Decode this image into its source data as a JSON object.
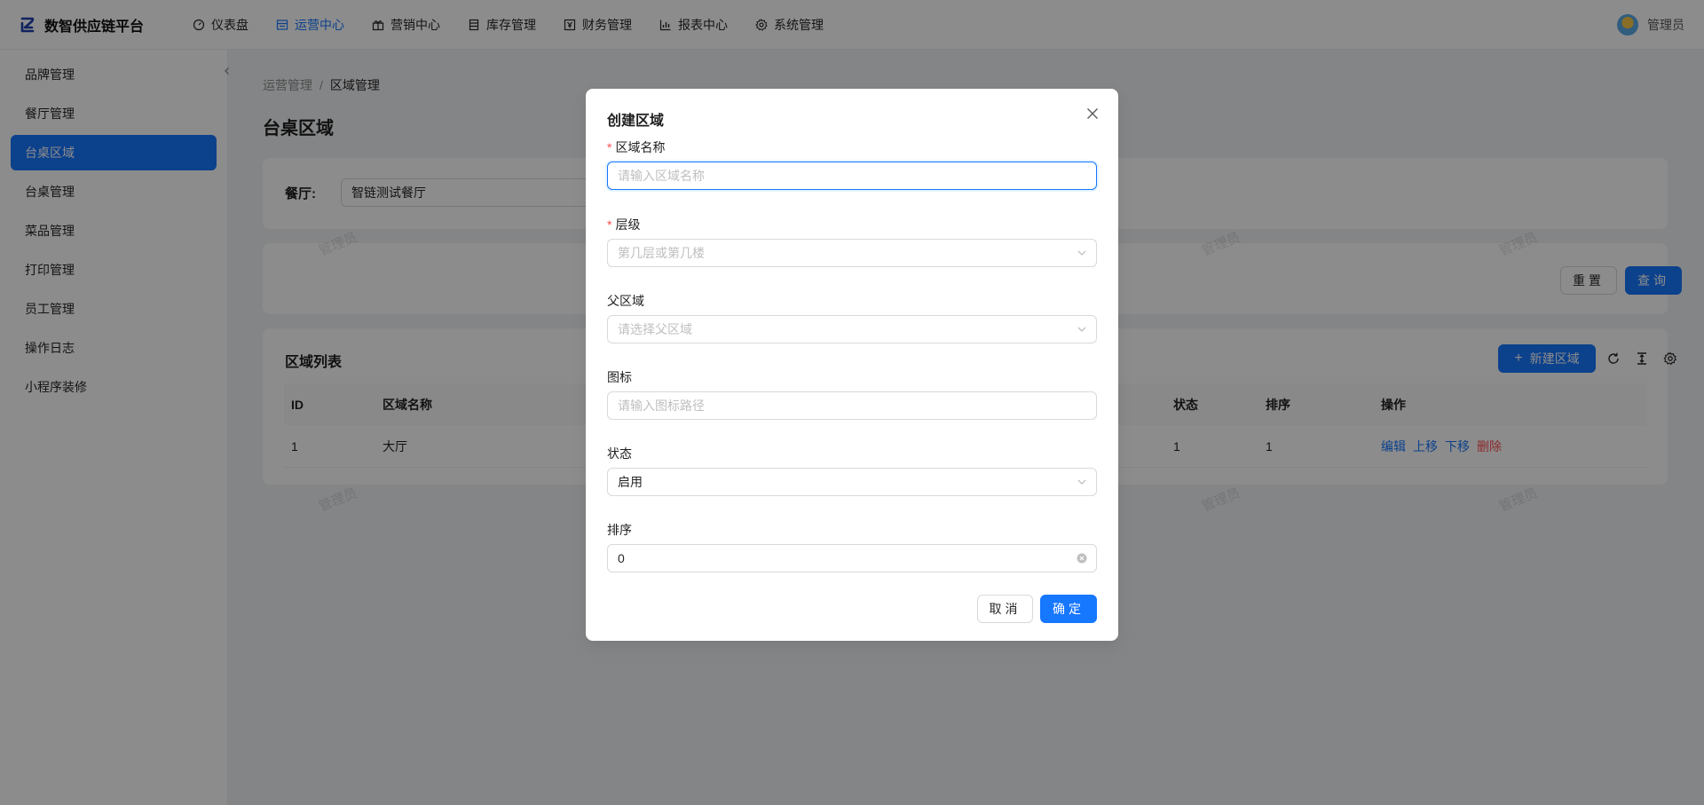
{
  "app": {
    "title": "数智供应链平台",
    "user_name": "管理员"
  },
  "topnav": [
    {
      "label": "仪表盘",
      "icon": "dashboard-icon",
      "active": false
    },
    {
      "label": "运营中心",
      "icon": "shop-icon",
      "active": true
    },
    {
      "label": "营销中心",
      "icon": "gift-icon",
      "active": false
    },
    {
      "label": "库存管理",
      "icon": "inventory-icon",
      "active": false
    },
    {
      "label": "财务管理",
      "icon": "finance-icon",
      "active": false
    },
    {
      "label": "报表中心",
      "icon": "chart-icon",
      "active": false
    },
    {
      "label": "系统管理",
      "icon": "gear-icon",
      "active": false
    }
  ],
  "sidebar": {
    "items": [
      {
        "label": "品牌管理"
      },
      {
        "label": "餐厅管理"
      },
      {
        "label": "台桌区域",
        "active": true
      },
      {
        "label": "台桌管理"
      },
      {
        "label": "菜品管理"
      },
      {
        "label": "打印管理"
      },
      {
        "label": "员工管理"
      },
      {
        "label": "操作日志"
      },
      {
        "label": "小程序装修"
      }
    ]
  },
  "breadcrumb": [
    "运营管理",
    "区域管理"
  ],
  "page_title": "台桌区域",
  "filter": {
    "label": "餐厅:",
    "value": "智链测试餐厅"
  },
  "actions": {
    "reset": "重置",
    "query": "查询"
  },
  "list": {
    "title": "区域列表",
    "add_button": "新建区域",
    "columns": [
      "ID",
      "区域名称",
      "状态",
      "排序",
      "操作"
    ],
    "rows": [
      {
        "id": "1",
        "name": "大厅",
        "status": "1",
        "sort": "1",
        "ops": [
          "编辑",
          "上移",
          "下移",
          "删除"
        ]
      }
    ]
  },
  "watermark_text": "管理员",
  "modal": {
    "title": "创建区域",
    "fields": {
      "name": {
        "label": "区域名称",
        "placeholder": "请输入区域名称"
      },
      "level": {
        "label": "层级",
        "placeholder": "第几层或第几楼"
      },
      "parent": {
        "label": "父区域",
        "placeholder": "请选择父区域"
      },
      "icon": {
        "label": "图标",
        "placeholder": "请输入图标路径"
      },
      "status": {
        "label": "状态",
        "value": "启用"
      },
      "sort": {
        "label": "排序",
        "value": "0"
      }
    },
    "cancel": "取消",
    "ok": "确定"
  },
  "colors": {
    "primary": "#1677ff",
    "danger": "#ff4d4f",
    "mask": "rgba(0,0,0,0.45)"
  }
}
